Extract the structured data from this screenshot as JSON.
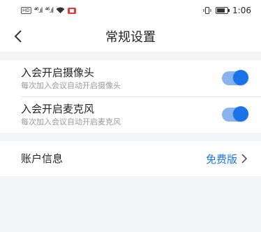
{
  "status_bar": {
    "hd_label": "HD",
    "signal1": "⁴⁶.ıl",
    "signal2": "⁴⁶.ıl",
    "time": "1:06"
  },
  "header": {
    "title": "常规设置",
    "back_icon": "chevron-left-icon"
  },
  "settings": {
    "items": [
      {
        "label": "入会开启摄像头",
        "description": "每次加入会议自动开启摄像头",
        "enabled": true
      },
      {
        "label": "入会开启麦克风",
        "description": "每次加入会议自动开启麦克风",
        "enabled": true
      }
    ]
  },
  "account": {
    "label": "账户信息",
    "value": "免费版",
    "arrow_icon": "chevron-right-icon"
  },
  "colors": {
    "accent": "#1a73e8",
    "background": "#f4f5f7"
  }
}
